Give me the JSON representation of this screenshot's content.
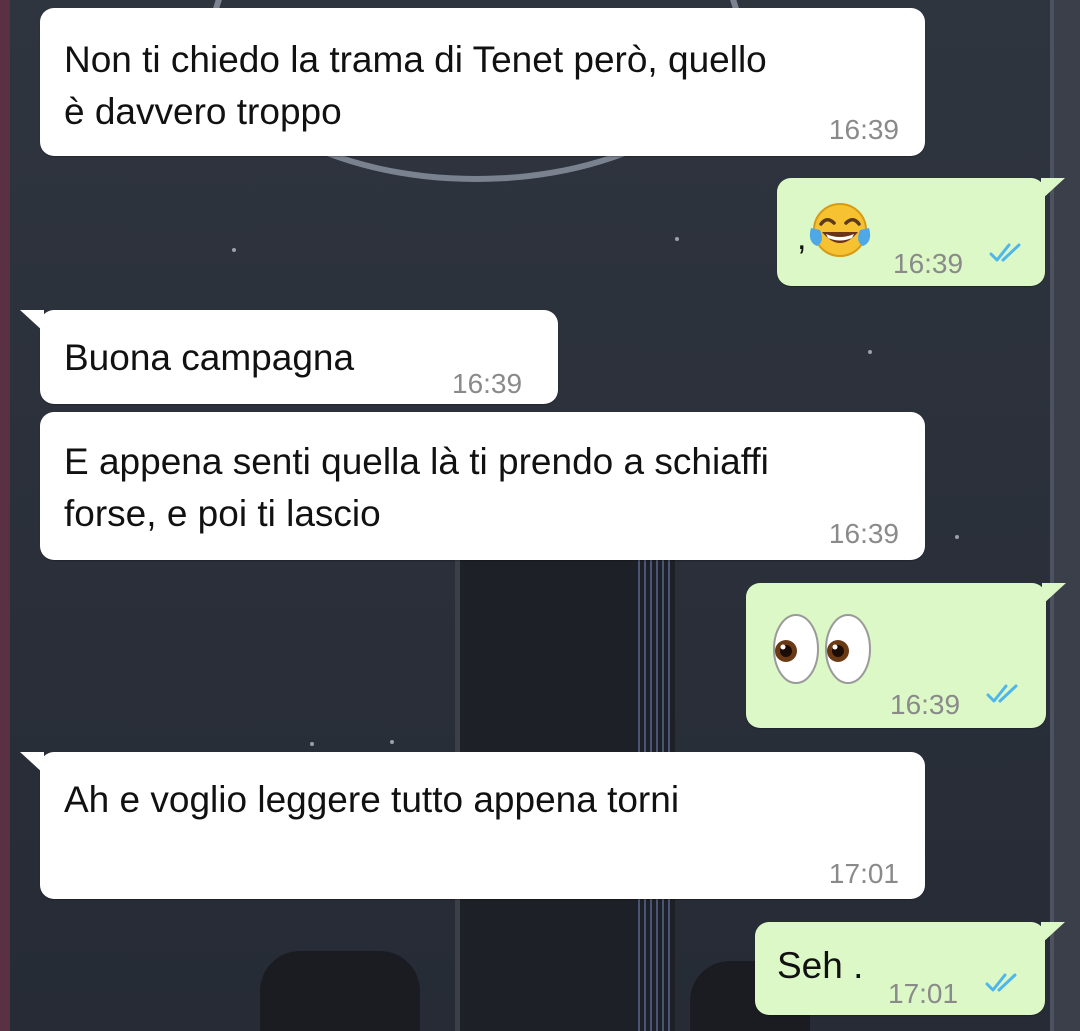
{
  "messages": [
    {
      "direction": "incoming",
      "text_line1": "Non ti chiedo la trama di Tenet però, quello",
      "text_line2": "è davvero troppo",
      "time": "16:39"
    },
    {
      "direction": "outgoing",
      "prefix": ",",
      "emoji": "face-with-tears-of-joy",
      "time": "16:39",
      "status": "read"
    },
    {
      "direction": "incoming",
      "text": "Buona campagna",
      "time": "16:39"
    },
    {
      "direction": "incoming",
      "text_line1": "E appena senti quella là ti prendo a schiaffi",
      "text_line2": "forse, e poi ti lascio",
      "time": "16:39"
    },
    {
      "direction": "outgoing",
      "emoji": "eyes",
      "time": "16:39",
      "status": "read"
    },
    {
      "direction": "incoming",
      "text": "Ah e voglio leggere tutto appena torni",
      "time": "17:01"
    },
    {
      "direction": "outgoing",
      "text": "Seh .",
      "time": "17:01",
      "status": "read"
    }
  ],
  "colors": {
    "incoming_bubble": "#ffffff",
    "outgoing_bubble": "#dcf8c6",
    "read_tick": "#4fb6ec",
    "timestamp": "#8a8a8a"
  }
}
